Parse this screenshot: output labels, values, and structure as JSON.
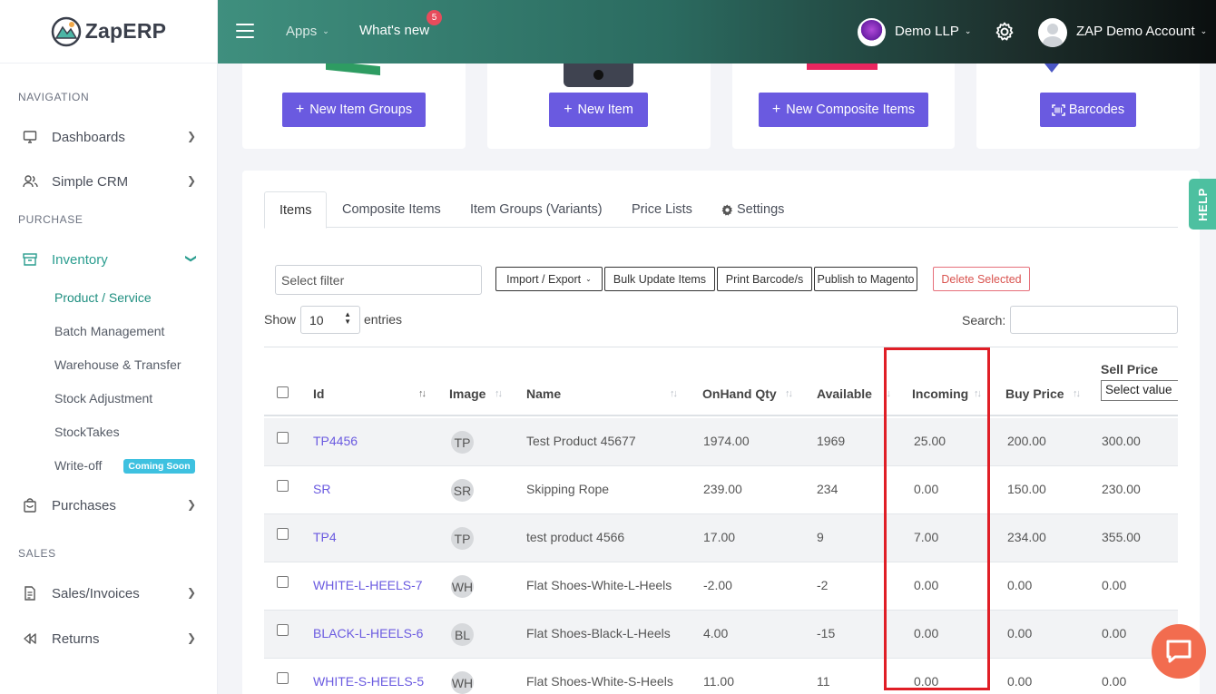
{
  "brand": {
    "name": "ZapERP"
  },
  "header": {
    "apps_label": "Apps",
    "whats_new_label": "What's new",
    "whats_new_count": "5",
    "company": "Demo LLP",
    "user": "ZAP Demo Account"
  },
  "sidebar": {
    "sections": {
      "navigation": "NAVIGATION",
      "purchase": "PURCHASE",
      "sales": "SALES"
    },
    "items": {
      "dashboards": "Dashboards",
      "crm": "Simple CRM",
      "inventory": "Inventory",
      "purchases": "Purchases",
      "sales_invoices": "Sales/Invoices",
      "returns": "Returns"
    },
    "inventory_sub": {
      "product": "Product / Service",
      "batch": "Batch Management",
      "warehouse": "Warehouse & Transfer",
      "stock_adj": "Stock Adjustment",
      "stocktakes": "StockTakes",
      "writeoff": "Write-off",
      "coming_soon": "Coming Soon"
    }
  },
  "cards": {
    "item_groups": "New Item Groups",
    "item": "New Item",
    "composite": "New Composite Items",
    "barcodes": "Barcodes"
  },
  "tabs": {
    "items": "Items",
    "composite": "Composite Items",
    "groups": "Item Groups (Variants)",
    "price_lists": "Price Lists",
    "settings": "Settings"
  },
  "toolbar": {
    "filter_placeholder": "Select filter",
    "import_export": "Import / Export",
    "bulk_update": "Bulk Update Items",
    "print_barcode": "Print Barcode/s",
    "publish": "Publish to Magento",
    "delete_selected": "Delete Selected"
  },
  "table_controls": {
    "show": "Show",
    "page_size": "10",
    "entries": "entries",
    "search": "Search:"
  },
  "table": {
    "headers": {
      "id": "Id",
      "image": "Image",
      "name": "Name",
      "onhand": "OnHand Qty",
      "available": "Available",
      "incoming": "Incoming",
      "buy": "Buy Price",
      "sell": "Sell Price",
      "sell_filter": "Select value"
    },
    "rows": [
      {
        "id": "TP4456",
        "thumb": "TP",
        "name": "Test Product 45677",
        "onhand": "1974.00",
        "available": "1969",
        "incoming": "25.00",
        "buy": "200.00",
        "sell": "300.00"
      },
      {
        "id": "SR",
        "thumb": "SR",
        "name": "Skipping Rope",
        "onhand": "239.00",
        "available": "234",
        "incoming": "0.00",
        "buy": "150.00",
        "sell": "230.00"
      },
      {
        "id": "TP4",
        "thumb": "TP",
        "name": "test product 4566",
        "onhand": "17.00",
        "available": "9",
        "incoming": "7.00",
        "buy": "234.00",
        "sell": "355.00"
      },
      {
        "id": "WHITE-L-HEELS-7",
        "thumb": "WH",
        "name": "Flat Shoes-White-L-Heels",
        "onhand": "-2.00",
        "available": "-2",
        "incoming": "0.00",
        "buy": "0.00",
        "sell": "0.00"
      },
      {
        "id": "BLACK-L-HEELS-6",
        "thumb": "BL",
        "name": "Flat Shoes-Black-L-Heels",
        "onhand": "4.00",
        "available": "-15",
        "incoming": "0.00",
        "buy": "0.00",
        "sell": "0.00"
      },
      {
        "id": "WHITE-S-HEELS-5",
        "thumb": "WH",
        "name": "Flat Shoes-White-S-Heels",
        "onhand": "11.00",
        "available": "11",
        "incoming": "0.00",
        "buy": "0.00",
        "sell": "0.00"
      }
    ]
  },
  "help_label": "HELP",
  "colors": {
    "accent": "#6a5ae0",
    "brand_green": "#2a9d8f",
    "highlight": "#e01e26"
  }
}
